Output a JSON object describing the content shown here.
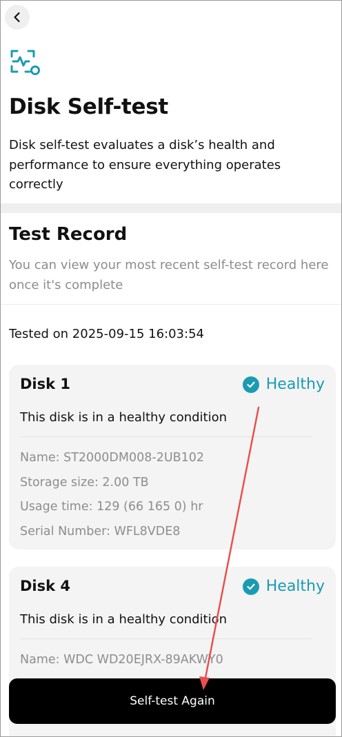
{
  "header": {
    "back_icon": "chevron-left-icon",
    "logo_icon": "disk-health-scan-icon",
    "title": "Disk Self-test",
    "description": "Disk self-test evaluates a disk’s health and performance to ensure everything operates correctly"
  },
  "record": {
    "title": "Test Record",
    "subtitle": "You can view your most recent self-test record here once it's complete",
    "tested_on": "Tested on 2025-09-15 16:03:54"
  },
  "disks": [
    {
      "name": "Disk 1",
      "status": "Healthy",
      "condition": "This disk is in a healthy condition",
      "model": "Name: ST2000DM008-2UB102",
      "storage": "Storage size: 2.00 TB",
      "usage": "Usage time: 129 (66 165 0) hr",
      "serial": "Serial Number: WFL8VDE8"
    },
    {
      "name": "Disk 4",
      "status": "Healthy",
      "condition": "This disk is in a healthy condition",
      "model": "Name: WDC WD20EJRX-89AKWY0"
    }
  ],
  "actions": {
    "retest_label": "Self-test Again"
  },
  "colors": {
    "accent": "#1a9bb2",
    "annotation": "#e8504f"
  }
}
